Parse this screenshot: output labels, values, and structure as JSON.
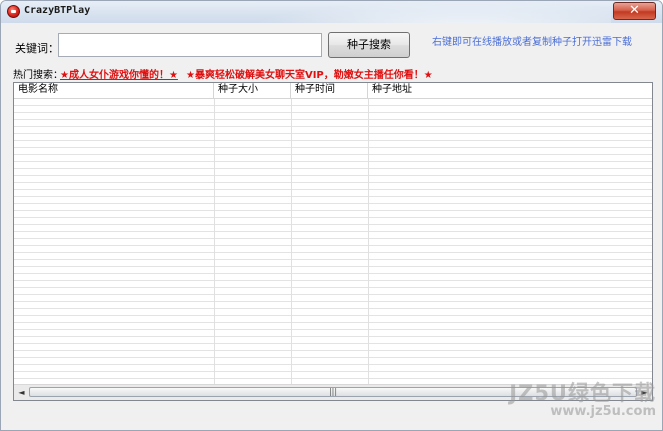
{
  "window": {
    "title": "CrazyBTPlay",
    "close_label": "✕"
  },
  "search": {
    "keyword_label": "关键词：",
    "keyword_value": "",
    "button_label": "种子搜索",
    "hint": "右键即可在线播放或者复制种子打开迅雷下载"
  },
  "hot": {
    "label": "热门搜索：",
    "item1": "★成人女仆游戏你懂的！★",
    "item2": "★暴爽轻松破解美女聊天室VIP，勒嫩女主播任你看！★"
  },
  "table": {
    "columns": [
      "电影名称",
      "种子大小",
      "种子时间",
      "种子地址"
    ],
    "rows": []
  },
  "scrollbar": {
    "left_arrow": "◄",
    "right_arrow": "►",
    "thumb_grip": "|||"
  },
  "watermark": {
    "top": "JZ5U绿色下载",
    "bottom": "www.jz5u.com"
  }
}
